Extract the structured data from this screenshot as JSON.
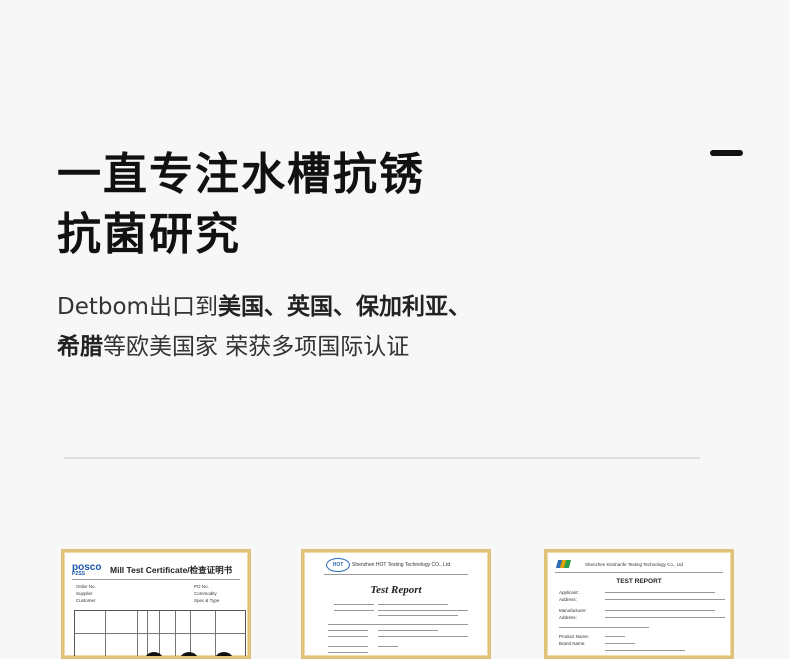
{
  "headline": {
    "line1": "一直专注水槽抗锈",
    "line2": "抗菌研究"
  },
  "subheading": {
    "l1_plain": "Detbom出口到",
    "l1_bold": "美国、英国、保加利亚、",
    "l2_bold": "希腊",
    "l2_plain": "等欧美国家  荣获多项国际认证"
  },
  "certificates": [
    {
      "brand": "posco",
      "brand_sub": "PZSS",
      "title": "Mill Test Certificate/检查证明书",
      "fields": [
        "Order No.",
        "Supplier",
        "Customer",
        "PO No.",
        "Commodity",
        "Spec & Type"
      ]
    },
    {
      "brand": "HOT",
      "company": "Shenzhen HOT Testing Technology CO., Ltd",
      "title": "Test Report"
    },
    {
      "company": "Shenzhen Kinshunfe Testing Technology Co., Ltd",
      "title": "TEST REPORT",
      "fields": [
        "Applicant:",
        "Address:",
        "Manufacturer:",
        "Address:",
        "Product Name:",
        "Brand Name:"
      ]
    }
  ]
}
